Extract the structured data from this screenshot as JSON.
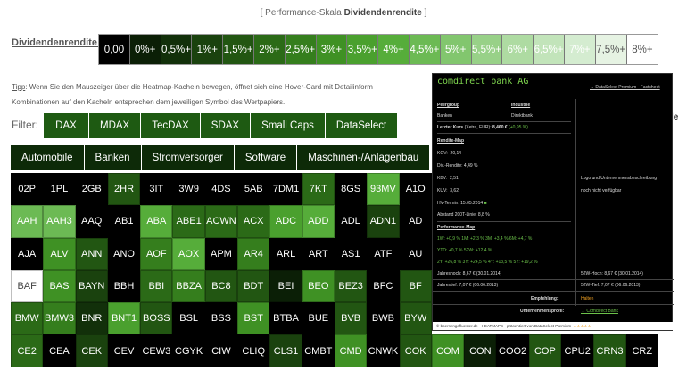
{
  "caption": {
    "prefix": "[ Performance-Skala ",
    "bold": "Dividendenrendite",
    "suffix": " ]"
  },
  "scale": {
    "label": "Dividendenrendite:",
    "cells": [
      {
        "label": "0,00",
        "color": "#000000",
        "text": "#ffffff"
      },
      {
        "label": "0%+",
        "color": "#0b1f06",
        "text": "#ffffff"
      },
      {
        "label": "0,5%+",
        "color": "#12300a",
        "text": "#ffffff"
      },
      {
        "label": "1%+",
        "color": "#1a420e",
        "text": "#ffffff"
      },
      {
        "label": "1,5%+",
        "color": "#225612",
        "text": "#ffffff"
      },
      {
        "label": "2%+",
        "color": "#2b6a17",
        "text": "#ffffff"
      },
      {
        "label": "2,5%+",
        "color": "#357e1d",
        "text": "#ffffff"
      },
      {
        "label": "3%+",
        "color": "#3f9124",
        "text": "#ffffff"
      },
      {
        "label": "3,5%+",
        "color": "#4aa02e",
        "text": "#ffffff"
      },
      {
        "label": "4%+",
        "color": "#56ad3a",
        "text": "#ffffff"
      },
      {
        "label": "4,5%+",
        "color": "#6cba54",
        "text": "#ffffff"
      },
      {
        "label": "5%+",
        "color": "#82c66e",
        "text": "#ffffff"
      },
      {
        "label": "5,5%+",
        "color": "#98d188",
        "text": "#ffffff"
      },
      {
        "label": "6%+",
        "color": "#aedba2",
        "text": "#ffffff"
      },
      {
        "label": "6,5%+",
        "color": "#c2e4ba",
        "text": "#ffffff"
      },
      {
        "label": "7%+",
        "color": "#d4ecd0",
        "text": "#ffffff"
      },
      {
        "label": "7,5%+",
        "color": "#e6f3e3",
        "text": "#555555"
      },
      {
        "label": "8%+",
        "color": "#ffffff",
        "text": "#555555"
      }
    ]
  },
  "tip": {
    "label": "Tipp",
    "text": ": Wenn Sie den Mauszeiger über die Heatmap-Kacheln bewegen, öffnet sich eine Hover-Card mit Detailinform",
    "text2": "Kombinationen auf den Kacheln entsprechen dem jeweiligen Symbol des Wertpapiers."
  },
  "filter": {
    "label": "Filter:",
    "indices": [
      "DAX",
      "MDAX",
      "TecDAX",
      "SDAX",
      "Small Caps",
      "DataSelect"
    ],
    "sectors": [
      "Automobile",
      "Banken",
      "Stromversorger",
      "Software",
      "Maschinen-/Anlagenbau"
    ]
  },
  "tiles": [
    [
      {
        "s": "02P",
        "c": "#000000"
      },
      {
        "s": "1PL",
        "c": "#000000"
      },
      {
        "s": "2GB",
        "c": "#000000"
      },
      {
        "s": "2HR",
        "c": "#225612"
      },
      {
        "s": "3IT",
        "c": "#000000"
      },
      {
        "s": "3W9",
        "c": "#000000"
      },
      {
        "s": "4DS",
        "c": "#000000"
      },
      {
        "s": "5AB",
        "c": "#000000"
      },
      {
        "s": "7DM1",
        "c": "#000000"
      },
      {
        "s": "7KT",
        "c": "#2b6a17"
      },
      {
        "s": "8GS",
        "c": "#000000"
      },
      {
        "s": "93MV",
        "c": "#56ad3a"
      },
      {
        "s": "A1O",
        "c": "#000000"
      }
    ],
    [
      {
        "s": "AAH",
        "c": "#6cba54"
      },
      {
        "s": "AAH3",
        "c": "#6cba54"
      },
      {
        "s": "AAQ",
        "c": "#000000"
      },
      {
        "s": "AB1",
        "c": "#000000"
      },
      {
        "s": "ABA",
        "c": "#56ad3a"
      },
      {
        "s": "ABE1",
        "c": "#2b6a17"
      },
      {
        "s": "ACWN",
        "c": "#2b6a17"
      },
      {
        "s": "ACX",
        "c": "#2b6a17"
      },
      {
        "s": "ADC",
        "c": "#4aa02e"
      },
      {
        "s": "ADD",
        "c": "#56ad3a"
      },
      {
        "s": "ADL",
        "c": "#000000"
      },
      {
        "s": "ADN1",
        "c": "#1a420e"
      },
      {
        "s": "AD",
        "c": "#000000"
      }
    ],
    [
      {
        "s": "AJA",
        "c": "#000000"
      },
      {
        "s": "ALV",
        "c": "#3f9124"
      },
      {
        "s": "ANN",
        "c": "#225612"
      },
      {
        "s": "ANO",
        "c": "#000000"
      },
      {
        "s": "AOF",
        "c": "#357e1d"
      },
      {
        "s": "AOX",
        "c": "#56ad3a"
      },
      {
        "s": "APM",
        "c": "#000000"
      },
      {
        "s": "AR4",
        "c": "#357e1d"
      },
      {
        "s": "ARL",
        "c": "#000000"
      },
      {
        "s": "ART",
        "c": "#000000"
      },
      {
        "s": "AS1",
        "c": "#000000"
      },
      {
        "s": "ATF",
        "c": "#000000"
      },
      {
        "s": "AU",
        "c": "#000000"
      }
    ],
    [
      {
        "s": "BAF",
        "c": "#ffffff",
        "t": "#444444"
      },
      {
        "s": "BAS",
        "c": "#3f9124"
      },
      {
        "s": "BAYN",
        "c": "#1a420e"
      },
      {
        "s": "BBH",
        "c": "#000000"
      },
      {
        "s": "BBI",
        "c": "#2b6a17"
      },
      {
        "s": "BBZA",
        "c": "#357e1d"
      },
      {
        "s": "BC8",
        "c": "#225612"
      },
      {
        "s": "BDT",
        "c": "#225612"
      },
      {
        "s": "BEI",
        "c": "#0b1f06"
      },
      {
        "s": "BEO",
        "c": "#3f9124"
      },
      {
        "s": "BEZ3",
        "c": "#225612"
      },
      {
        "s": "BFC",
        "c": "#000000"
      },
      {
        "s": "BF",
        "c": "#225612"
      }
    ],
    [
      {
        "s": "BMW",
        "c": "#2b6a17"
      },
      {
        "s": "BMW3",
        "c": "#357e1d"
      },
      {
        "s": "BNR",
        "c": "#12300a"
      },
      {
        "s": "BNT1",
        "c": "#4aa02e"
      },
      {
        "s": "BOSS",
        "c": "#225612"
      },
      {
        "s": "BSL",
        "c": "#000000"
      },
      {
        "s": "BSS",
        "c": "#000000"
      },
      {
        "s": "BST",
        "c": "#3f9124"
      },
      {
        "s": "BTBA",
        "c": "#000000"
      },
      {
        "s": "BUE",
        "c": "#000000"
      },
      {
        "s": "BVB",
        "c": "#225612"
      },
      {
        "s": "BWB",
        "c": "#000000"
      },
      {
        "s": "BYW",
        "c": "#225612"
      }
    ],
    [
      {
        "s": "CE2",
        "c": "#2b6a17"
      },
      {
        "s": "CEA",
        "c": "#000000"
      },
      {
        "s": "CEK",
        "c": "#1a420e"
      },
      {
        "s": "CEV",
        "c": "#000000"
      },
      {
        "s": "CEW3",
        "c": "#000000"
      },
      {
        "s": "CGYK",
        "c": "#000000"
      },
      {
        "s": "CIW",
        "c": "#000000"
      },
      {
        "s": "CLIQ",
        "c": "#000000"
      },
      {
        "s": "CLS1",
        "c": "#1a420e"
      },
      {
        "s": "CMBT",
        "c": "#000000"
      },
      {
        "s": "CMD",
        "c": "#3f9124"
      },
      {
        "s": "CNWK",
        "c": "#000000"
      },
      {
        "s": "COK",
        "c": "#225612"
      },
      {
        "s": "COM",
        "c": "#3f9124"
      },
      {
        "s": "CON",
        "c": "#0b1f06"
      },
      {
        "s": "COO2",
        "c": "#000000"
      },
      {
        "s": "COP",
        "c": "#225612"
      },
      {
        "s": "CPU2",
        "c": "#000000"
      },
      {
        "s": "CRN3",
        "c": "#225612"
      },
      {
        "s": "CRZ",
        "c": "#000000"
      }
    ]
  ],
  "hovercard": {
    "name": "comdirect bank AG",
    "factsheet": "→ DataSelect Premium - Factsheet",
    "peergroup_h": "Peergroup",
    "peergroup": "Banken",
    "industrie_h": "Industrie",
    "industrie": "Direktbank",
    "kurs_label": "Letzter Kurs",
    "kurs_sub": "(Xetra, EUR):",
    "kurs": "8,460 €",
    "kurs_chg": "(+0,95 %)",
    "rendite_h": "Rendite-Map",
    "kgv_l": "KGV:",
    "kgv": "20,14",
    "div_l": "Div.-Rendite:",
    "div": "4,49 %",
    "kbv_l": "KBV:",
    "kbv": "2,51",
    "kuv_l": "KUV:",
    "kuv": "3,62",
    "hv_l": "HV-Termin:",
    "hv": "15.05.2014",
    "abstand_l": "Abstand 200T-Linie:",
    "abstand": "8,8 %",
    "perf_h": "Performance-Map",
    "perf1": "1W:  +0,9 %   1M:  +2,3 %   3M:  +3,4 %   6M:  +4,7 %",
    "perf2": "YTD:  +0,7 %   52W:  +12,4 %",
    "perf3": "2Y:  +26,8 %   3Y:  +24,5 %   4Y:  +13,5 %   5Y:  +19,2 %",
    "logo_text": "Logo und Unternehmensbeschreibung",
    "logo_text2": "noch nicht verfügbar",
    "jt_l": "Jahreshoch:",
    "jt": "8,67 € (30.01.2014)",
    "jl_l": "Jahrestief:",
    "jl": "7,07 € (06.06.2013)",
    "w52h_l": "52W-Hoch:",
    "w52h": "8,67 € (30.01.2014)",
    "w52t_l": "52W-Tief:",
    "w52t": "7,07 € (06.06.2013)",
    "empf_l": "Empfehlung:",
    "empf": "Halten",
    "profil_l": "Unternehmensprofil:",
    "profil": "→ Comdirect Bank",
    "footer": "© boersengefluester.de · HEATMAPS · präsentiert von DataSelect Premium"
  },
  "stray": {
    "right1": "le",
    "right2": "C",
    "right3": "4"
  }
}
